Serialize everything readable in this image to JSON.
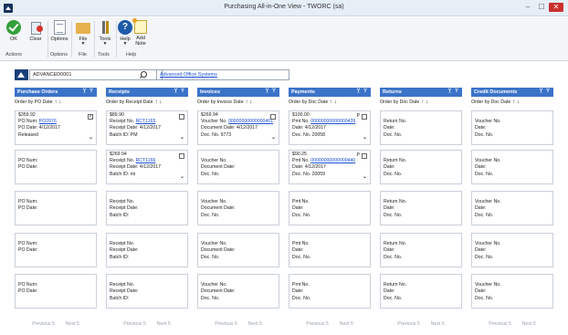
{
  "window": {
    "title": "Purchasing All-in-One View  -  TWORC (sa)",
    "min_glyph": "–",
    "max_glyph": "☐",
    "close_glyph": "✕"
  },
  "ribbon": {
    "ok_label": "OK",
    "clear_label": "Clear",
    "options_label": "Options",
    "file_label": "File",
    "tools_label": "Tools",
    "help_label": "Help",
    "add_note_label_1": "Add",
    "add_note_label_2": "Note",
    "dropdown_glyph": "▼",
    "help_glyph": "?",
    "groups": {
      "actions": "Actions",
      "options": "Options",
      "file": "File",
      "tools": "Tools",
      "help": "Help"
    }
  },
  "search": {
    "vendor_id": "ADVANCED0001",
    "vendor_name": "Advanced Office Systems"
  },
  "header_controls": "Y̲ Y",
  "arrows": "↑ ↓",
  "caret": "⌄",
  "columns": {
    "po": {
      "title": "Purchase Orders",
      "order_by": "Order by PO Date",
      "cards": [
        {
          "amount": "$359.92",
          "check": "✓",
          "num_label": "PO Num:",
          "num": "PO2076",
          "date_label": "PO Date:",
          "date": "4/12/2017",
          "status": "Released"
        },
        {
          "num_label": "PO Num:",
          "date_label": "PO Date:"
        },
        {
          "num_label": "PO Num:",
          "date_label": "PO Date:"
        },
        {
          "num_label": "PO Num:",
          "date_label": "PO Date:"
        },
        {
          "num_label": "PO Num:",
          "date_label": "PO Date:"
        }
      ]
    },
    "receipts": {
      "title": "Receipts",
      "order_by": "Order by Receipt Date",
      "cards": [
        {
          "amount": "$89.90",
          "num_label": "Receipt No.",
          "num": "RCT1165",
          "date_label": "Receipt Date:",
          "date": "4/12/2017",
          "batch_label": "Batch ID:",
          "batch": "PM"
        },
        {
          "amount": "$269.94",
          "num_label": "Receipt No.",
          "num": "RCT1166",
          "date_label": "Receipt Date:",
          "date": "4/12/2017",
          "batch_label": "Batch ID:",
          "batch": "mi"
        },
        {
          "num_label": "Receipt No.",
          "date_label": "Receipt Date:",
          "batch_label": "Batch ID:"
        },
        {
          "num_label": "Receipt No.",
          "date_label": "Receipt Date:",
          "batch_label": "Batch ID:"
        },
        {
          "num_label": "Receipt No.",
          "date_label": "Receipt Date:",
          "batch_label": "Batch ID:"
        }
      ]
    },
    "invoices": {
      "title": "Invoices",
      "order_by": "Order by Invoice Date",
      "cards": [
        {
          "amount": "$269.94",
          "num_label": "Voucher No.",
          "num": "00000000000000461",
          "date_label": "Document Date:",
          "date": "4/12/2017",
          "doc_label": "Doc. No.",
          "doc": "9773"
        },
        {
          "num_label": "Voucher No.",
          "date_label": "Document Date:",
          "doc_label": "Doc. No."
        },
        {
          "num_label": "Voucher No.",
          "date_label": "Document Date:",
          "doc_label": "Doc. No."
        },
        {
          "num_label": "Voucher No.",
          "date_label": "Document Date:",
          "doc_label": "Doc. No."
        },
        {
          "num_label": "Voucher No.",
          "date_label": "Document Date:",
          "doc_label": "Doc. No."
        }
      ]
    },
    "payments": {
      "title": "Payments",
      "order_by": "Order by Doc Date",
      "cards": [
        {
          "amount": "$100.00",
          "flag": "P",
          "num_label": "Pmt No.",
          "num": "00000000000000439",
          "date_label": "Date:",
          "date": "4/12/2017",
          "doc_label": "Doc. No.",
          "doc": "20058"
        },
        {
          "amount": "$90.25",
          "flag": "P",
          "num_label": "Pmt No.",
          "num": "00000000000000440",
          "date_label": "Date:",
          "date": "4/12/2017",
          "doc_label": "Doc. No.",
          "doc": "20059"
        },
        {
          "num_label": "Pmt No.",
          "date_label": "Date:",
          "doc_label": "Doc. No."
        },
        {
          "num_label": "Pmt No.",
          "date_label": "Date:",
          "doc_label": "Doc. No."
        },
        {
          "num_label": "Pmt No.",
          "date_label": "Date:",
          "doc_label": "Doc. No."
        }
      ]
    },
    "returns": {
      "title": "Returns",
      "order_by": "Order by Doc Date",
      "cards": [
        {
          "num_label": "Return No.",
          "date_label": "Date:",
          "doc_label": "Doc. No."
        },
        {
          "num_label": "Return No.",
          "date_label": "Date:",
          "doc_label": "Doc. No."
        },
        {
          "num_label": "Return No.",
          "date_label": "Date:",
          "doc_label": "Doc. No."
        },
        {
          "num_label": "Return No.",
          "date_label": "Date:",
          "doc_label": "Doc. No."
        },
        {
          "num_label": "Return No.",
          "date_label": "Date:",
          "doc_label": "Doc. No."
        }
      ]
    },
    "credits": {
      "title": "Credit Documents",
      "order_by": "Order by Doc Date",
      "cards": [
        {
          "num_label": "Voucher No.",
          "date_label": "Date:",
          "doc_label": "Doc. No."
        },
        {
          "num_label": "Voucher No.",
          "date_label": "Date:",
          "doc_label": "Doc. No."
        },
        {
          "num_label": "Voucher No.",
          "date_label": "Date:",
          "doc_label": "Doc. No."
        },
        {
          "num_label": "Voucher No.",
          "date_label": "Date:",
          "doc_label": "Doc. No."
        },
        {
          "num_label": "Voucher No.",
          "date_label": "Date:",
          "doc_label": "Doc. No."
        }
      ]
    }
  },
  "pager": {
    "prev": "Previous 5",
    "next": "Next 5"
  },
  "colors": {
    "header_blue": "#3b73c8",
    "link_blue": "#1a4fd6",
    "close_red": "#c9302c"
  }
}
